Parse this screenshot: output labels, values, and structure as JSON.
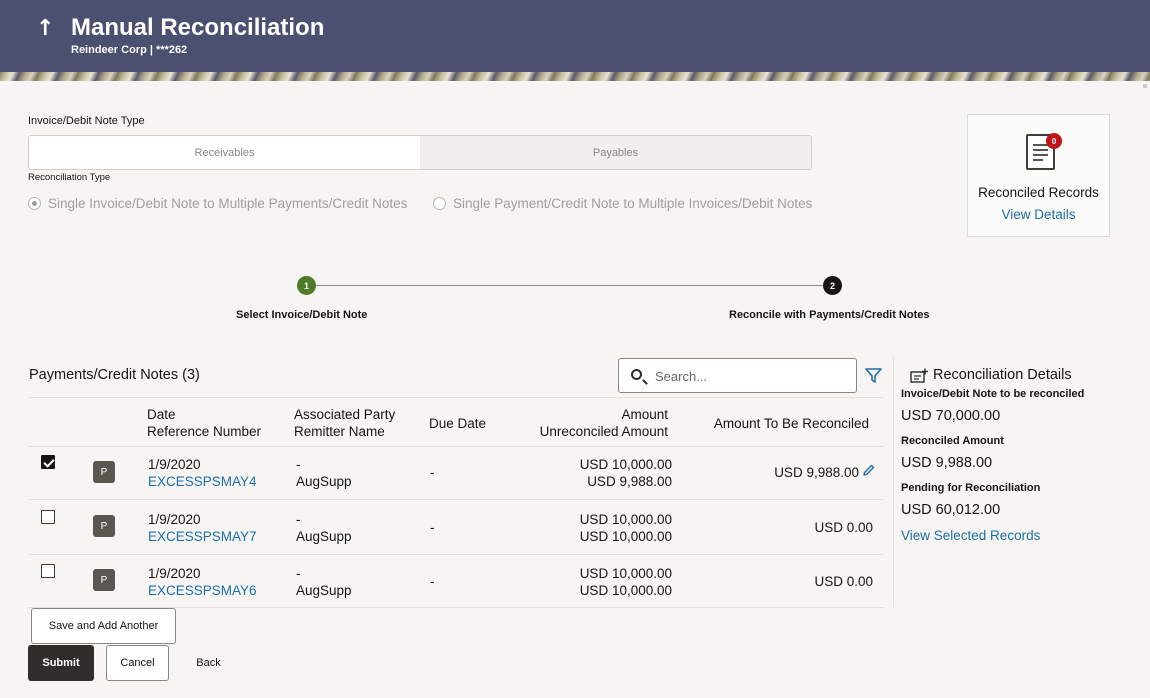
{
  "header": {
    "title": "Manual Reconciliation",
    "subtitle": "Reindeer Corp | ***262",
    "back_icon": "↑"
  },
  "invoice_type": {
    "label": "Invoice/Debit Note Type",
    "options": [
      "Receivables",
      "Payables"
    ],
    "selected": "Payables"
  },
  "reconciliation_type": {
    "label": "Reconciliation Type",
    "options": [
      "Single Invoice/Debit Note to Multiple Payments/Credit Notes",
      "Single Payment/Credit Note to Multiple Invoices/Debit Notes"
    ],
    "selected_index": 0
  },
  "reconciled_records": {
    "badge": "0",
    "label": "Reconciled Records",
    "link": "View Details"
  },
  "stepper": {
    "steps": [
      {
        "number": "1",
        "label": "Select Invoice/Debit Note",
        "color": "#4f7a28"
      },
      {
        "number": "2",
        "label": "Reconcile with Payments/Credit Notes",
        "color": "#161513"
      }
    ]
  },
  "payments": {
    "title": "Payments/Credit Notes (3)",
    "search_placeholder": "Search...",
    "columns": {
      "date_ref_1": "Date",
      "date_ref_2": "Reference Number",
      "party_1": "Associated Party",
      "party_2": "Remitter Name",
      "due_date": "Due Date",
      "amount_1": "Amount",
      "amount_2": "Unreconciled Amount",
      "to_reconcile": "Amount To Be Reconciled"
    },
    "rows": [
      {
        "checked": true,
        "tag": "P",
        "date": "1/9/2020",
        "ref": "EXCESSPSMAY4",
        "party": "-",
        "remitter": "AugSupp",
        "due": "-",
        "amount": "USD 10,000.00",
        "unreconciled": "USD 9,988.00",
        "to_reconcile": "USD 9,988.00"
      },
      {
        "checked": false,
        "tag": "P",
        "date": "1/9/2020",
        "ref": "EXCESSPSMAY7",
        "party": "-",
        "remitter": "AugSupp",
        "due": "-",
        "amount": "USD 10,000.00",
        "unreconciled": "USD 10,000.00",
        "to_reconcile": "USD 0.00"
      },
      {
        "checked": false,
        "tag": "P",
        "date": "1/9/2020",
        "ref": "EXCESSPSMAY6",
        "party": "-",
        "remitter": "AugSupp",
        "due": "-",
        "amount": "USD 10,000.00",
        "unreconciled": "USD 10,000.00",
        "to_reconcile": "USD 0.00"
      }
    ]
  },
  "reconciliation_details": {
    "title": "Reconciliation Details",
    "invoice_label": "Invoice/Debit Note to be reconciled",
    "invoice_value": "USD 70,000.00",
    "reconciled_label": "Reconciled Amount",
    "reconciled_value": "USD 9,988.00",
    "pending_label": "Pending for Reconciliation",
    "pending_value": "USD 60,012.00",
    "link": "View Selected Records"
  },
  "actions": {
    "save_add": "Save and Add Another",
    "submit": "Submit",
    "cancel": "Cancel",
    "back": "Back"
  }
}
